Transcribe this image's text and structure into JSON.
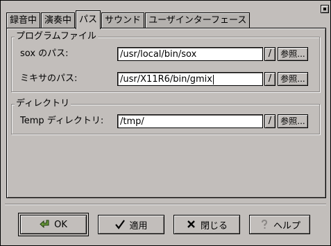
{
  "tabs": [
    {
      "label": "録音中",
      "active": false
    },
    {
      "label": "演奏中",
      "active": false
    },
    {
      "label": "パス",
      "active": true
    },
    {
      "label": "サウンド",
      "active": false
    },
    {
      "label": "ユーザインターフェース",
      "active": false
    }
  ],
  "program_files": {
    "title": "プログラムファイル",
    "sox": {
      "label": "sox のパス:",
      "value": "/usr/local/bin/sox",
      "slash": "/",
      "browse": "参照..."
    },
    "mixer": {
      "label": "ミキサのパス:",
      "value": "/usr/X11R6/bin/gmix",
      "slash": "/",
      "browse": "参照..."
    }
  },
  "directory": {
    "title": "ディレクトリ",
    "temp": {
      "label": "Temp ディレクトリ:",
      "value": "/tmp/",
      "slash": "/",
      "browse": "参照..."
    }
  },
  "buttons": {
    "ok": {
      "label": "OK",
      "icon": "ok-arrow-icon"
    },
    "apply": {
      "label": "適用",
      "icon": "checkmark-icon"
    },
    "close": {
      "label": "閉じる",
      "icon": "x-icon"
    },
    "help": {
      "label": "ヘルプ",
      "icon": "question-icon"
    }
  }
}
